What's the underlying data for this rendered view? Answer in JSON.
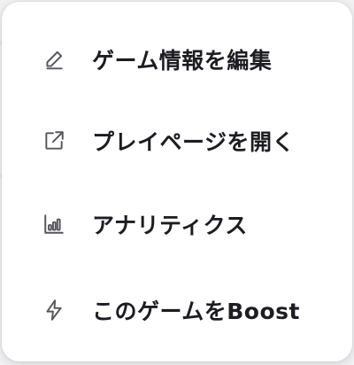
{
  "menu": {
    "items": [
      {
        "label": "ゲーム情報を編集",
        "icon": "pencil-icon"
      },
      {
        "label": "プレイページを開く",
        "icon": "external-link-icon"
      },
      {
        "label": "アナリティクス",
        "icon": "bar-chart-icon"
      },
      {
        "label": "このゲームをBoost",
        "icon": "lightning-bolt-icon"
      }
    ]
  },
  "colors": {
    "menu_background": "#ffffff",
    "label_text": "#1c1c22",
    "icon": "#55555e"
  }
}
